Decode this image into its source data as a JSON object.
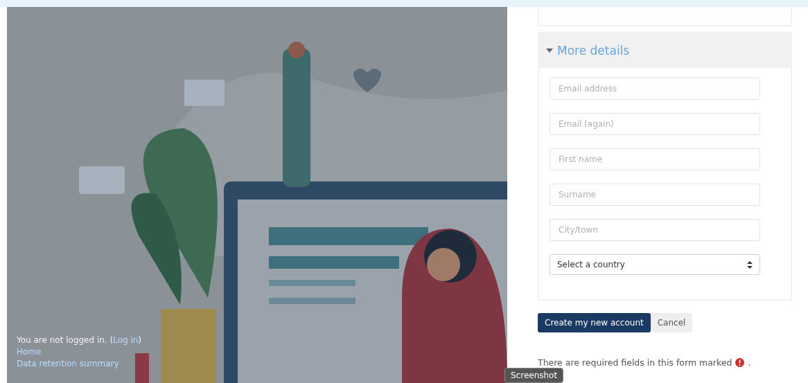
{
  "section": {
    "title": "More details",
    "expanded": true
  },
  "fields": [
    {
      "kind": "text",
      "placeholder": "Email address"
    },
    {
      "kind": "text",
      "placeholder": "Email (again)"
    },
    {
      "kind": "text",
      "placeholder": "First name"
    },
    {
      "kind": "text",
      "placeholder": "Surname"
    },
    {
      "kind": "text",
      "placeholder": "City/town"
    },
    {
      "kind": "select",
      "value": "Select a country"
    }
  ],
  "buttons": [
    {
      "label": "Create my new account",
      "kind": "primary"
    },
    {
      "label": "Cancel",
      "kind": "secondary"
    }
  ],
  "required_note": {
    "text": "There are required fields in this form marked",
    "suffix": "."
  },
  "footer": {
    "login_text": "You are not logged in. (",
    "login_link": "Log in",
    "login_close": ")",
    "links": [
      "Home",
      "Data retention summary"
    ]
  },
  "tooltip": "Screenshot"
}
